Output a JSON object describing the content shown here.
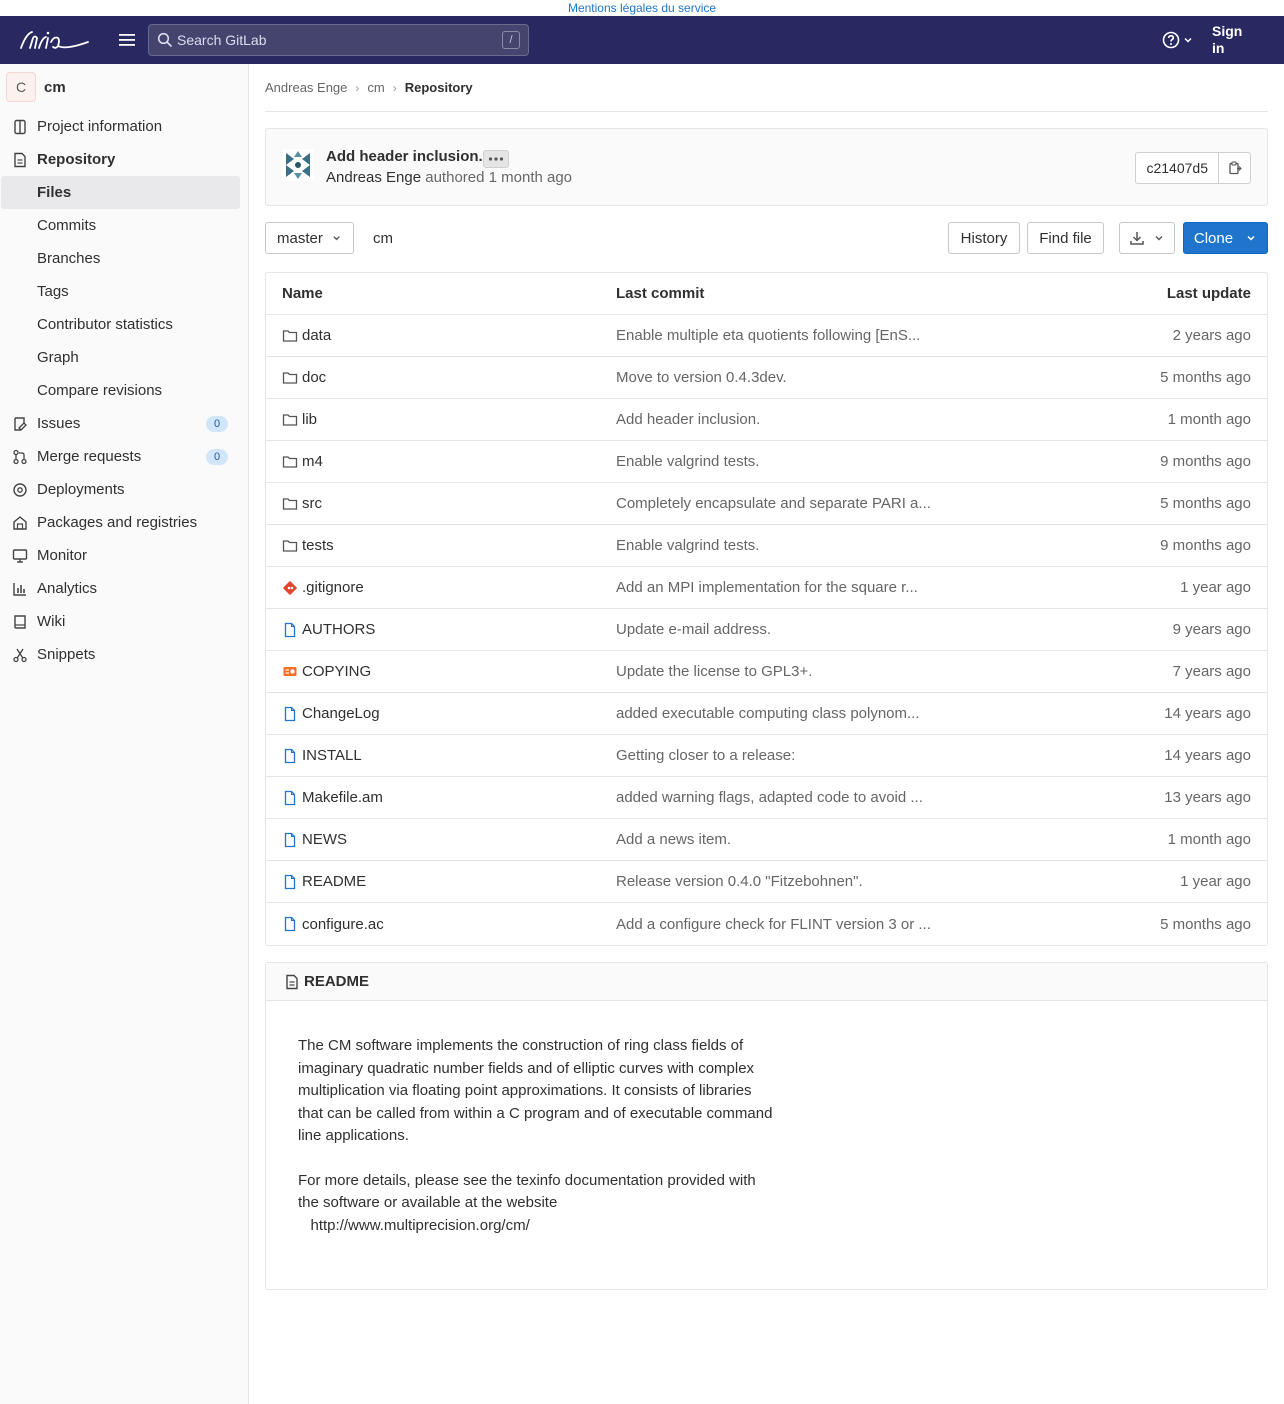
{
  "legal": {
    "text": "Mentions légales du service"
  },
  "topbar": {
    "search_placeholder": "Search GitLab",
    "search_shortcut": "/",
    "sign_in_line1": "Sign",
    "sign_in_line2": "in"
  },
  "project": {
    "avatar_letter": "C",
    "name": "cm"
  },
  "sidebar": {
    "project_information": "Project information",
    "repository": "Repository",
    "sub": {
      "files": "Files",
      "commits": "Commits",
      "branches": "Branches",
      "tags": "Tags",
      "contributor_statistics": "Contributor statistics",
      "graph": "Graph",
      "compare_revisions": "Compare revisions"
    },
    "issues": "Issues",
    "issues_count": "0",
    "merge_requests": "Merge requests",
    "merge_requests_count": "0",
    "deployments": "Deployments",
    "packages": "Packages and registries",
    "monitor": "Monitor",
    "analytics": "Analytics",
    "wiki": "Wiki",
    "snippets": "Snippets"
  },
  "breadcrumb": {
    "owner": "Andreas Enge",
    "project": "cm",
    "current": "Repository"
  },
  "commit": {
    "title": "Add header inclusion.",
    "author": "Andreas Enge",
    "meta_suffix": " authored 1 month ago",
    "sha": "c21407d5"
  },
  "toolbar": {
    "branch": "master",
    "path": "cm",
    "history": "History",
    "find_file": "Find file",
    "clone": "Clone"
  },
  "table": {
    "headers": {
      "name": "Name",
      "last_commit": "Last commit",
      "last_update": "Last update"
    },
    "rows": [
      {
        "name": "data",
        "commit": "Enable multiple eta quotients following [EnS...",
        "update": "2 years ago"
      },
      {
        "name": "doc",
        "commit": "Move to version 0.4.3dev.",
        "update": "5 months ago"
      },
      {
        "name": "lib",
        "commit": "Add header inclusion.",
        "update": "1 month ago"
      },
      {
        "name": "m4",
        "commit": "Enable valgrind tests.",
        "update": "9 months ago"
      },
      {
        "name": "src",
        "commit": "Completely encapsulate and separate PARI a...",
        "update": "5 months ago"
      },
      {
        "name": "tests",
        "commit": "Enable valgrind tests.",
        "update": "9 months ago"
      },
      {
        "name": ".gitignore",
        "commit": "Add an MPI implementation for the square r...",
        "update": "1 year ago"
      },
      {
        "name": "AUTHORS",
        "commit": "Update e-mail address.",
        "update": "9 years ago"
      },
      {
        "name": "COPYING",
        "commit": "Update the license to GPL3+.",
        "update": "7 years ago"
      },
      {
        "name": "ChangeLog",
        "commit": "added executable computing class polynom...",
        "update": "14 years ago"
      },
      {
        "name": "INSTALL",
        "commit": "Getting closer to a release:",
        "update": "14 years ago"
      },
      {
        "name": "Makefile.am",
        "commit": "added warning flags, adapted code to avoid ...",
        "update": "13 years ago"
      },
      {
        "name": "NEWS",
        "commit": "Add a news item.",
        "update": "1 month ago"
      },
      {
        "name": "README",
        "commit": "Release version 0.4.0 \"Fitzebohnen\".",
        "update": "1 year ago"
      },
      {
        "name": "configure.ac",
        "commit": "Add a configure check for FLINT version 3 or ...",
        "update": "5 months ago"
      }
    ]
  },
  "readme": {
    "title": "README",
    "para1": "The CM software implements the construction of ring class fields of\nimaginary quadratic number fields and of elliptic curves with complex\nmultiplication via floating point approximations. It consists of libraries\nthat can be called from within a C program and of executable command\nline applications.",
    "para2": "For more details, please see the texinfo documentation provided with\nthe software or available at the website\n   http://www.multiprecision.org/cm/"
  }
}
